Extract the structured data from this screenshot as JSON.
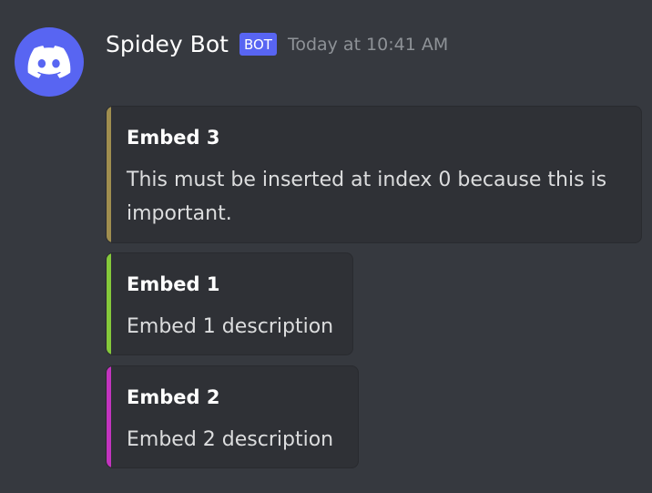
{
  "message": {
    "author": "Spidey Bot",
    "bot_tag": "BOT",
    "timestamp": "Today at 10:41 AM",
    "avatar_icon": "discord-logo-icon",
    "avatar_color": "#5865f2"
  },
  "embeds": [
    {
      "title": "Embed 3",
      "description": "This must be inserted at index 0 because this is important.",
      "color": "#a08e4f"
    },
    {
      "title": "Embed 1",
      "description": "Embed 1 description",
      "color": "#85c93b"
    },
    {
      "title": "Embed 2",
      "description": "Embed 2 description",
      "color": "#c334bf"
    }
  ]
}
